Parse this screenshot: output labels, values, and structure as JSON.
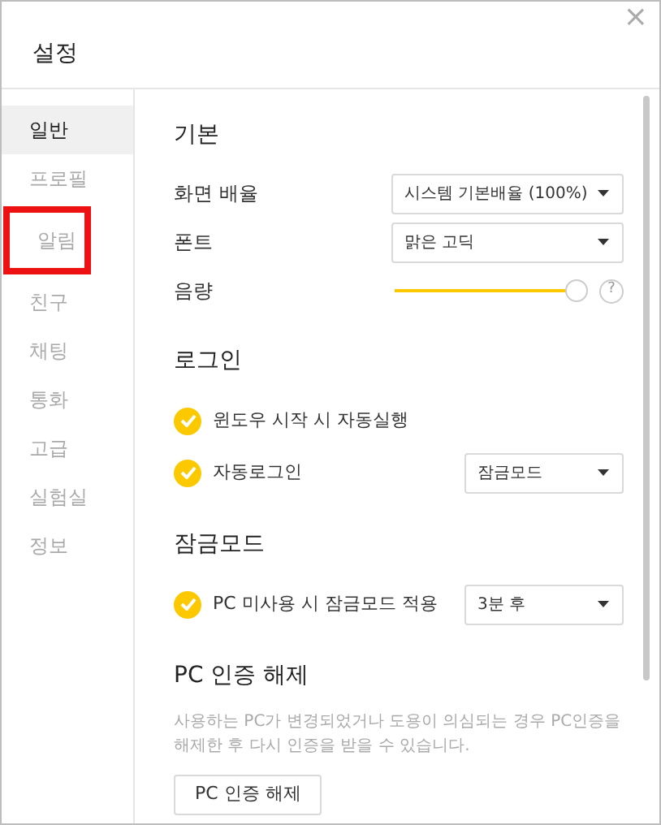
{
  "window": {
    "title": "설정",
    "close": "×"
  },
  "sidebar": {
    "items": [
      {
        "label": "일반",
        "selected": true,
        "highlighted": false
      },
      {
        "label": "프로필",
        "selected": false,
        "highlighted": false
      },
      {
        "label": "알림",
        "selected": false,
        "highlighted": true
      },
      {
        "label": "친구",
        "selected": false,
        "highlighted": false
      },
      {
        "label": "채팅",
        "selected": false,
        "highlighted": false
      },
      {
        "label": "통화",
        "selected": false,
        "highlighted": false
      },
      {
        "label": "고급",
        "selected": false,
        "highlighted": false
      },
      {
        "label": "실험실",
        "selected": false,
        "highlighted": false
      },
      {
        "label": "정보",
        "selected": false,
        "highlighted": false
      }
    ]
  },
  "sections": [
    {
      "title": "기본",
      "rows": [
        {
          "kind": "select",
          "label": "화면 배율",
          "value": "시스템 기본배율 (100%)"
        },
        {
          "kind": "select",
          "label": "폰트",
          "value": "맑은 고딕"
        },
        {
          "kind": "slider",
          "label": "음량",
          "level": 1,
          "help": "?"
        }
      ]
    },
    {
      "title": "로그인",
      "rows": [
        {
          "kind": "check",
          "label": "윈도우 시작 시 자동실행",
          "checked": true
        },
        {
          "kind": "check",
          "label": "자동로그인",
          "checked": true,
          "value": "잠금모드"
        }
      ]
    },
    {
      "title": "잠금모드",
      "rows": [
        {
          "kind": "check",
          "label": "PC 미사용 시 잠금모드 적용",
          "checked": true,
          "value": "3분 후"
        }
      ]
    },
    {
      "title": "PC 인증 해제",
      "rows": [
        {
          "kind": "text",
          "label": "사용하는 PC가 변경되었거나 도용이 의심되는 경우 PC인증을 해제한 후 다시 인증을 받을 수 있습니다."
        },
        {
          "kind": "button",
          "label": "PC 인증 해제"
        }
      ]
    }
  ]
}
